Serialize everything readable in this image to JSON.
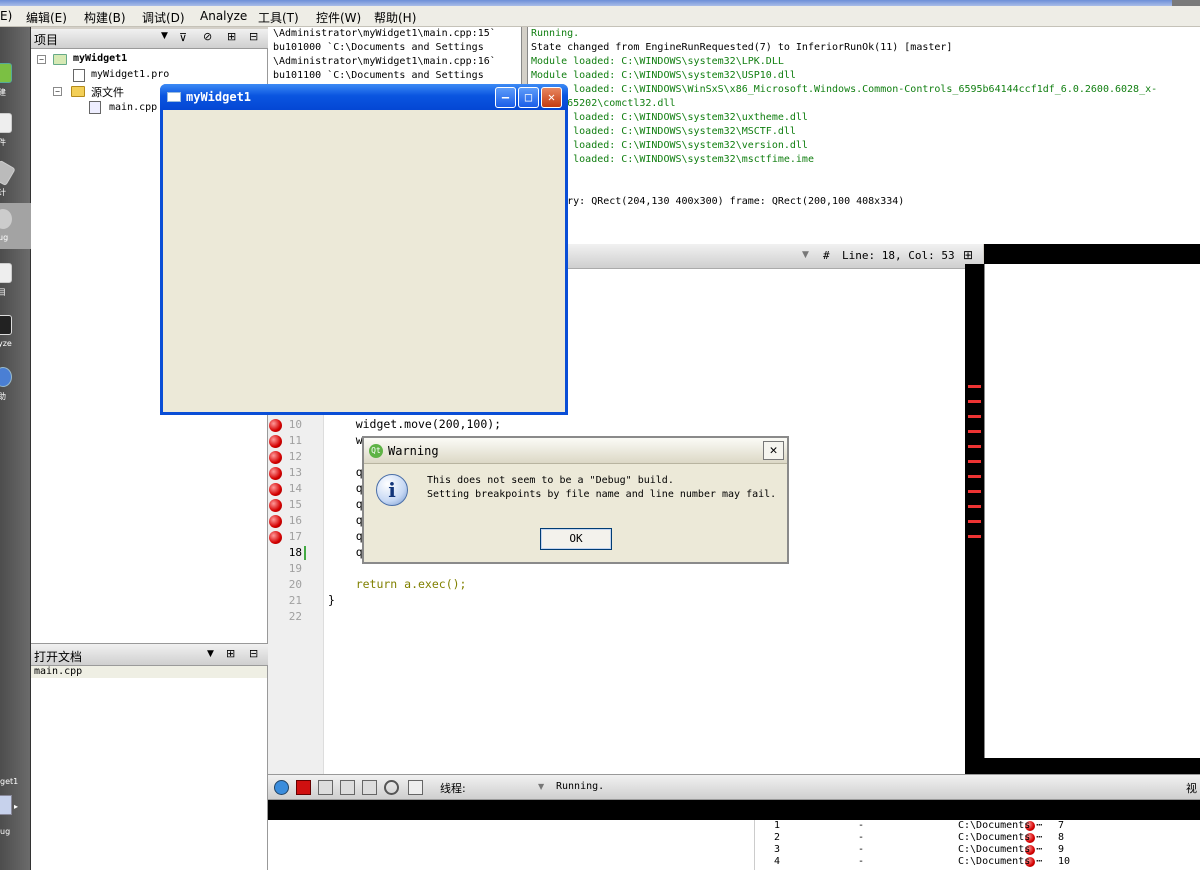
{
  "menu": {
    "items": [
      "E)",
      "编辑(E)",
      "构建(B)",
      "调试(D)",
      "Analyze",
      "工具(T)",
      "控件(W)",
      "帮助(H)"
    ]
  },
  "modes": {
    "items": [
      "建",
      "件",
      "计",
      "ug",
      "目",
      "yze",
      "助"
    ],
    "bottom_label": "get1",
    "bottom_label2": "ug"
  },
  "project_panel": {
    "title": "项目",
    "root": "myWidget1",
    "pro_file": "myWidget1.pro",
    "sources_folder": "源文件",
    "source_file": "main.cpp"
  },
  "open_docs": {
    "title": "打开文档",
    "items": [
      "main.cpp"
    ]
  },
  "breakpoint_log": {
    "lines": [
      "\\Administrator\\myWidget1\\main.cpp:15`",
      "bu101000 `C:\\Documents and Settings",
      "\\Administrator\\myWidget1\\main.cpp:16`",
      "bu101100 `C:\\Documents and Settings"
    ]
  },
  "app_log": {
    "lines": [
      {
        "text": "Running.",
        "green": true
      },
      {
        "text": "State changed from EngineRunRequested(7) to InferiorRunOk(11) [master]",
        "green": false
      },
      {
        "text": "Module loaded: C:\\WINDOWS\\system32\\LPK.DLL",
        "green": true
      },
      {
        "text": "Module loaded: C:\\WINDOWS\\system32\\USP10.dll",
        "green": true
      },
      {
        "text": "Module loaded: C:\\WINDOWS\\WinSxS\\x86_Microsoft.Windows.Common-Controls_6595b64144ccf1df_6.0.2600.6028_x-",
        "green": true
      },
      {
        "text": "ww_61e65202\\comctl32.dll",
        "green": true
      },
      {
        "text": "Module loaded: C:\\WINDOWS\\system32\\uxtheme.dll",
        "green": true
      },
      {
        "text": "Module loaded: C:\\WINDOWS\\system32\\MSCTF.dll",
        "green": true
      },
      {
        "text": "Module loaded: C:\\WINDOWS\\system32\\version.dll",
        "green": true
      },
      {
        "text": "Module loaded: C:\\WINDOWS\\system32\\msctfime.ime",
        "green": true
      },
      {
        "text": "",
        "green": false
      },
      {
        "text": "",
        "green": false
      },
      {
        "text": "geometry: QRect(204,130 400x300) frame: QRect(200,100 408x334)",
        "green": false
      }
    ]
  },
  "editor_toolbar": {
    "hash": "#",
    "position": "Line: 18, Col: 53"
  },
  "editor": {
    "lines": [
      {
        "n": "10",
        "bp": true,
        "code": "    widget.move(200,100);"
      },
      {
        "n": "11",
        "bp": true,
        "code": "    w"
      },
      {
        "n": "12",
        "bp": true,
        "code": ""
      },
      {
        "n": "13",
        "bp": true,
        "code": "    q"
      },
      {
        "n": "14",
        "bp": true,
        "code": "    q"
      },
      {
        "n": "15",
        "bp": true,
        "code": "    q"
      },
      {
        "n": "16",
        "bp": true,
        "code": "    q"
      },
      {
        "n": "17",
        "bp": true,
        "code": "    q"
      },
      {
        "n": "18",
        "bp": false,
        "code": "    q"
      },
      {
        "n": "19",
        "bp": false,
        "code": ""
      },
      {
        "n": "20",
        "bp": false,
        "code": "    return a.exec();"
      },
      {
        "n": "21",
        "bp": false,
        "code": "}"
      },
      {
        "n": "22",
        "bp": false,
        "code": ""
      }
    ],
    "partial_text": ")"
  },
  "debug_toolbar": {
    "thread_label": "线程:",
    "status": "Running.",
    "right_label": "视"
  },
  "breakpoints_list": {
    "rows": [
      {
        "num": "1",
        "func": "-",
        "file": "C:\\Documents ⋯",
        "line": "7"
      },
      {
        "num": "2",
        "func": "-",
        "file": "C:\\Documents ⋯",
        "line": "8"
      },
      {
        "num": "3",
        "func": "-",
        "file": "C:\\Documents ⋯",
        "line": "9"
      },
      {
        "num": "4",
        "func": "-",
        "file": "C:\\Documents ⋯",
        "line": "10"
      }
    ]
  },
  "app_window": {
    "title": "myWidget1"
  },
  "warning_dialog": {
    "title": "Warning",
    "line1": "This does not seem to be a \"Debug\" build.",
    "line2": "Setting breakpoints by file name and line number may fail.",
    "ok_label": "OK"
  },
  "colors": {
    "xp_blue": "#0a4ed6",
    "breakpoint_red": "#d40000",
    "log_green": "#117f11",
    "keyword": "#808000"
  }
}
